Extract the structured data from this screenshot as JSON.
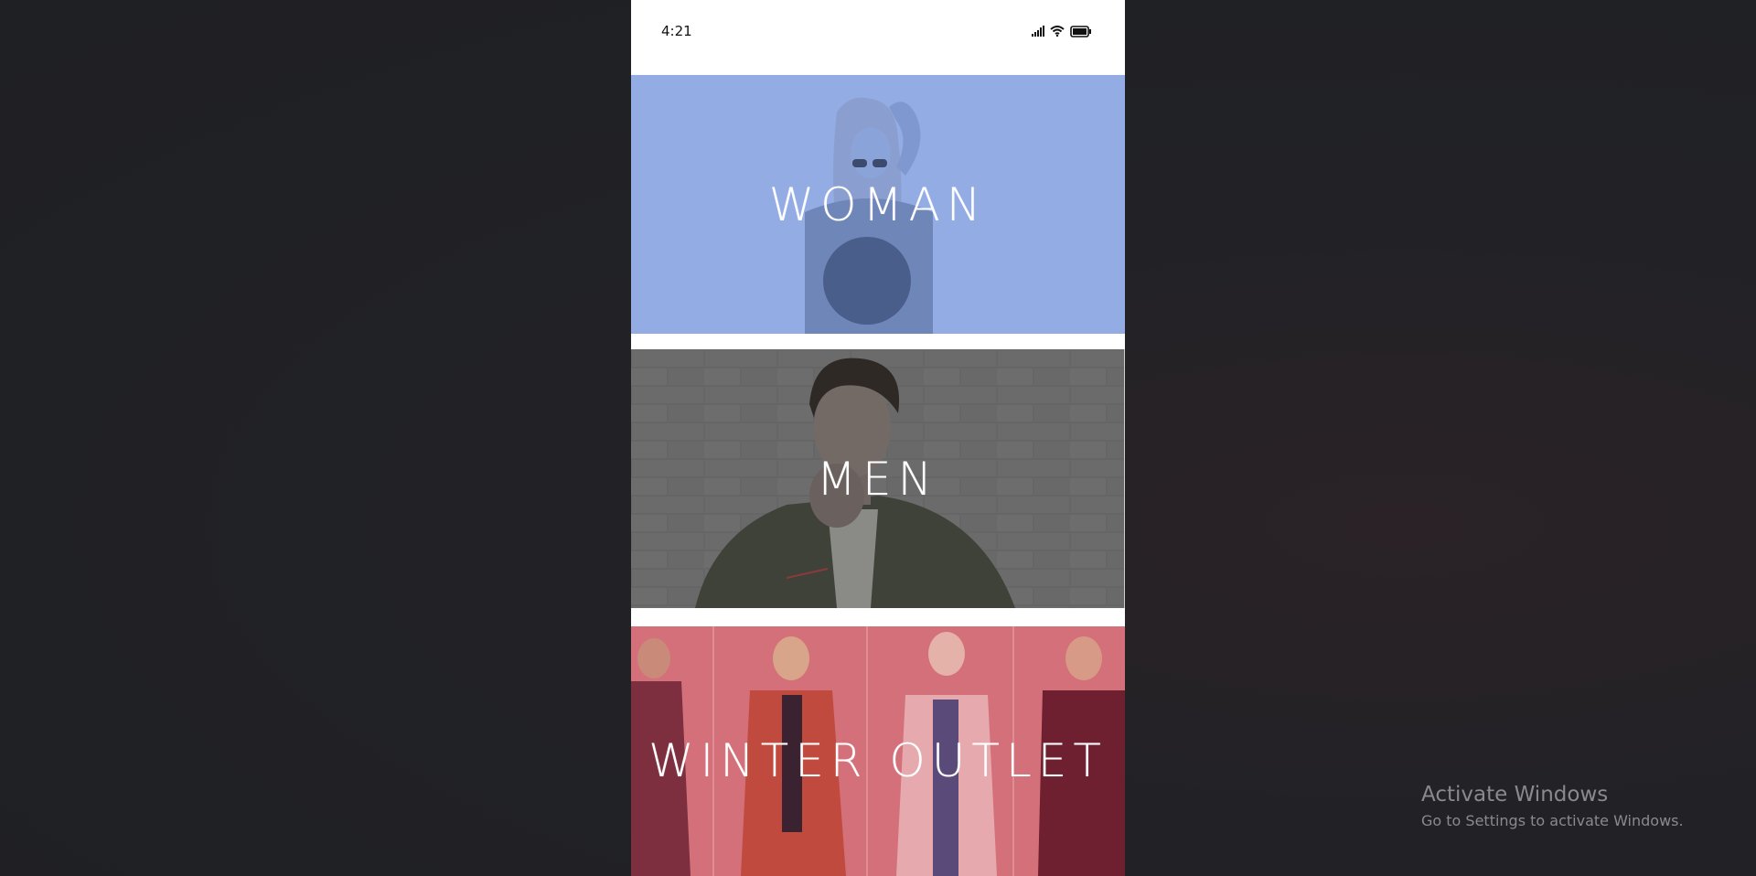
{
  "status_bar": {
    "time": "4:21",
    "icons": [
      "signal-icon",
      "wifi-icon",
      "battery-icon"
    ]
  },
  "categories": [
    {
      "label": "WOMAN",
      "overlay_color": "#8fabe3"
    },
    {
      "label": "MEN",
      "overlay_color": "#5a5a5a"
    },
    {
      "label": "WINTER OUTLET",
      "overlay_color": "#d06e76"
    }
  ],
  "watermark": {
    "title": "Activate Windows",
    "subtitle": "Go to Settings to activate Windows."
  }
}
